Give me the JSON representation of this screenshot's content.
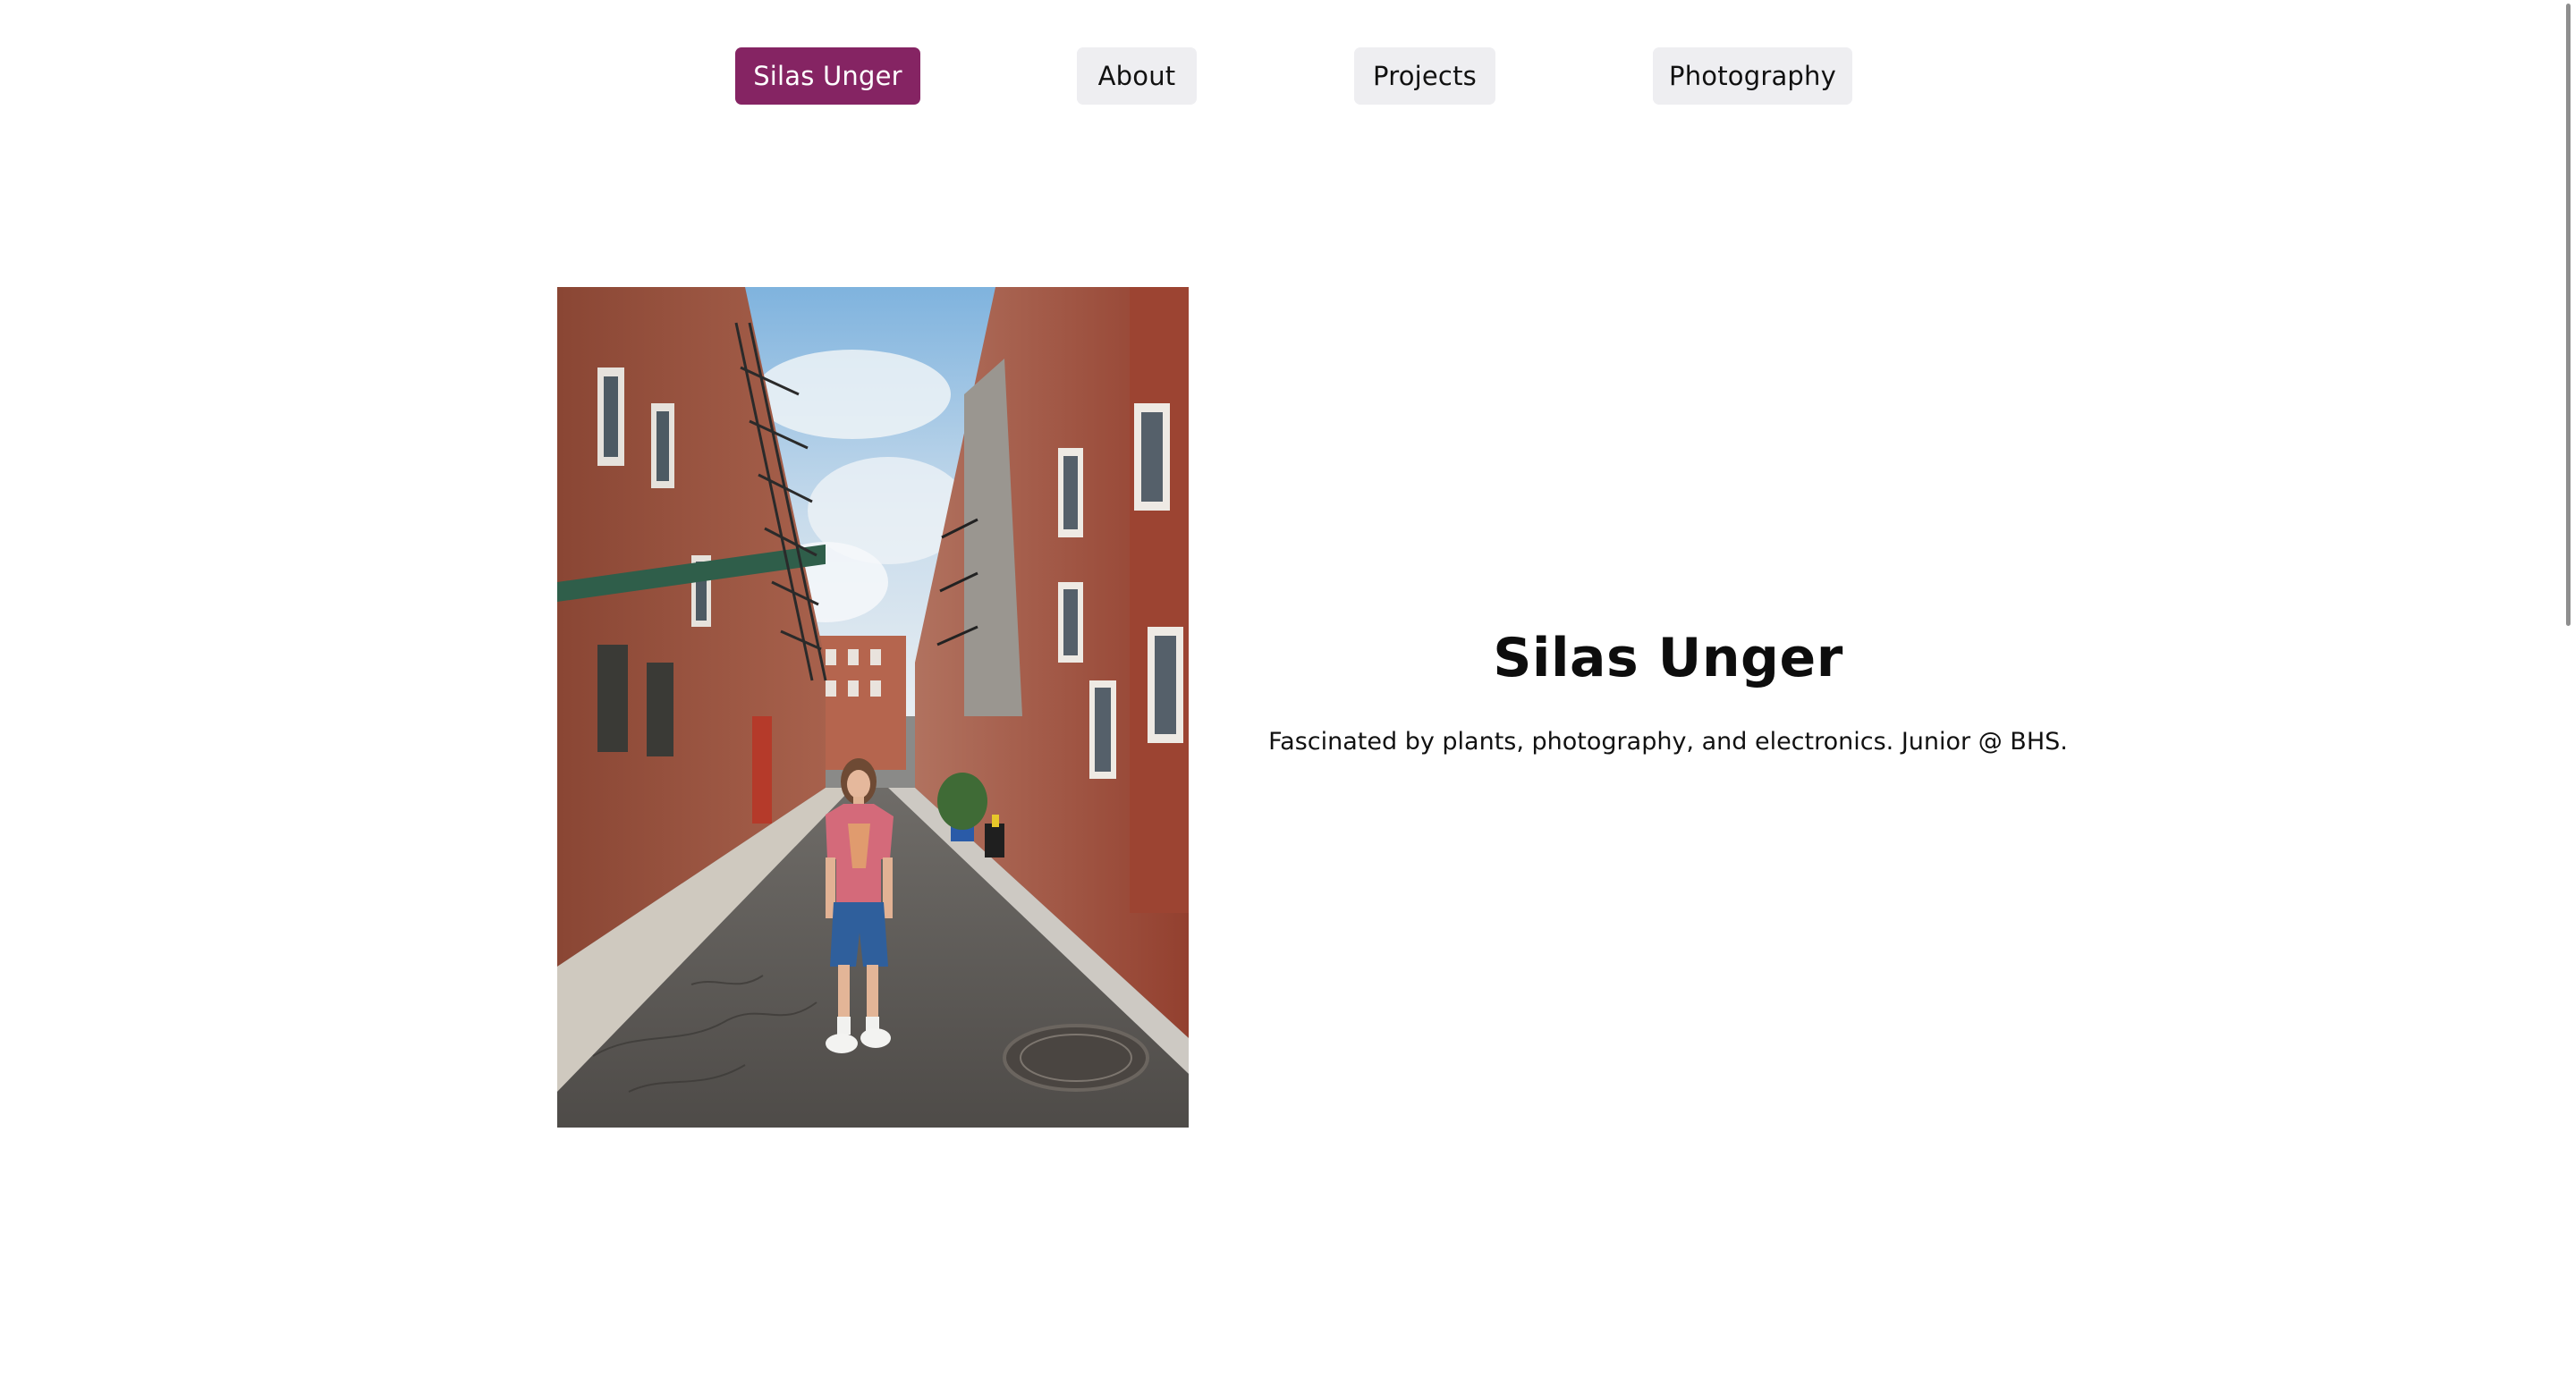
{
  "nav": {
    "items": [
      {
        "label": "Silas Unger",
        "active": true
      },
      {
        "label": "About",
        "active": false
      },
      {
        "label": "Projects",
        "active": false
      },
      {
        "label": "Photography",
        "active": false
      }
    ]
  },
  "hero": {
    "name": "Silas Unger",
    "tagline": "Fascinated by plants, photography, and electronics. Junior @ BHS."
  },
  "colors": {
    "accent": "#852463",
    "nav_bg": "#eeeef1",
    "text": "#111111",
    "background": "#ffffff"
  },
  "photo": {
    "subject": "person standing in a narrow brick-lined city street"
  }
}
